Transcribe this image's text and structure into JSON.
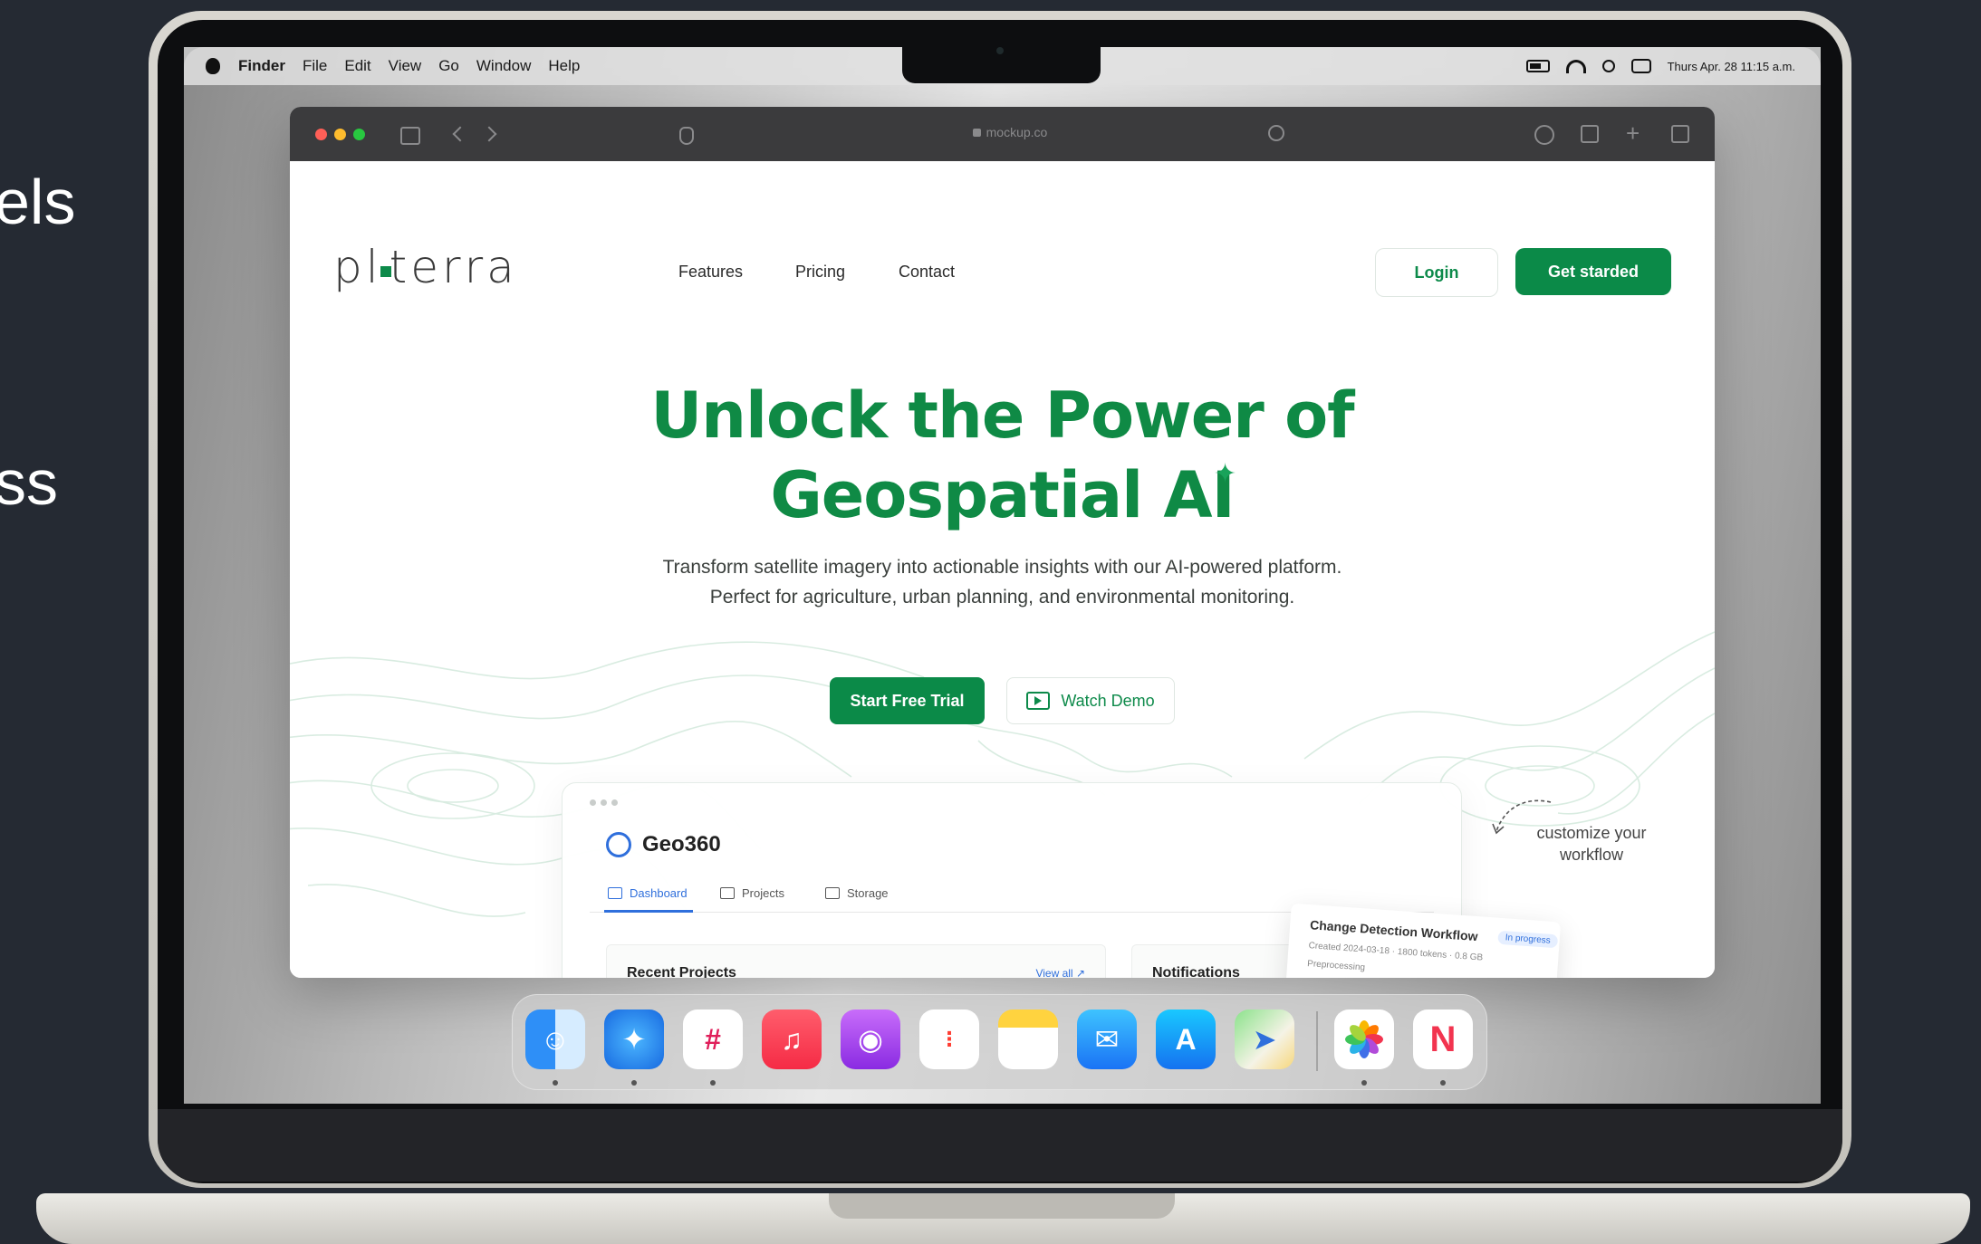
{
  "side_text": [
    "els",
    "ss"
  ],
  "menubar": {
    "finder": "Finder",
    "items": [
      "File",
      "Edit",
      "View",
      "Go",
      "Window",
      "Help"
    ],
    "clock": "Thurs Apr. 28 11:15 a.m."
  },
  "browser": {
    "url": "mockup.co"
  },
  "site": {
    "logo": {
      "before": "pl",
      "after": "terra"
    },
    "nav": [
      "Features",
      "Pricing",
      "Contact"
    ],
    "login": "Login",
    "get_started": "Get starded",
    "hero_line1": "Unlock the Power of",
    "hero_line2": "Geospatial AI",
    "sub_line1": "Transform satellite imagery into actionable insights with our AI-powered platform.",
    "sub_line2": "Perfect for agriculture, urban planning, and environmental monitoring.",
    "cta_trial": "Start Free Trial",
    "cta_demo": "Watch Demo",
    "customize": "customize your workflow",
    "accent": "#0b8a48"
  },
  "dashboard": {
    "app_name": "Geo360",
    "tabs": [
      "Dashboard",
      "Projects",
      "Storage"
    ],
    "recent_projects": "Recent Projects",
    "view_all": "View all",
    "notifications": "Notifications",
    "workflow": {
      "title": "Change Detection Workflow",
      "status": "In progress",
      "created": "Created 2024-03-18",
      "tokens": "1800 tokens",
      "size": "0.8 GB",
      "step": "Preprocessing"
    }
  },
  "dock": {
    "apps": [
      "finder-icon",
      "safari-icon",
      "slack-icon",
      "music-icon",
      "podcasts-icon",
      "reminders-icon",
      "notes-icon",
      "mail-icon",
      "app-store-icon",
      "maps-icon",
      "photos-icon",
      "news-icon"
    ]
  }
}
